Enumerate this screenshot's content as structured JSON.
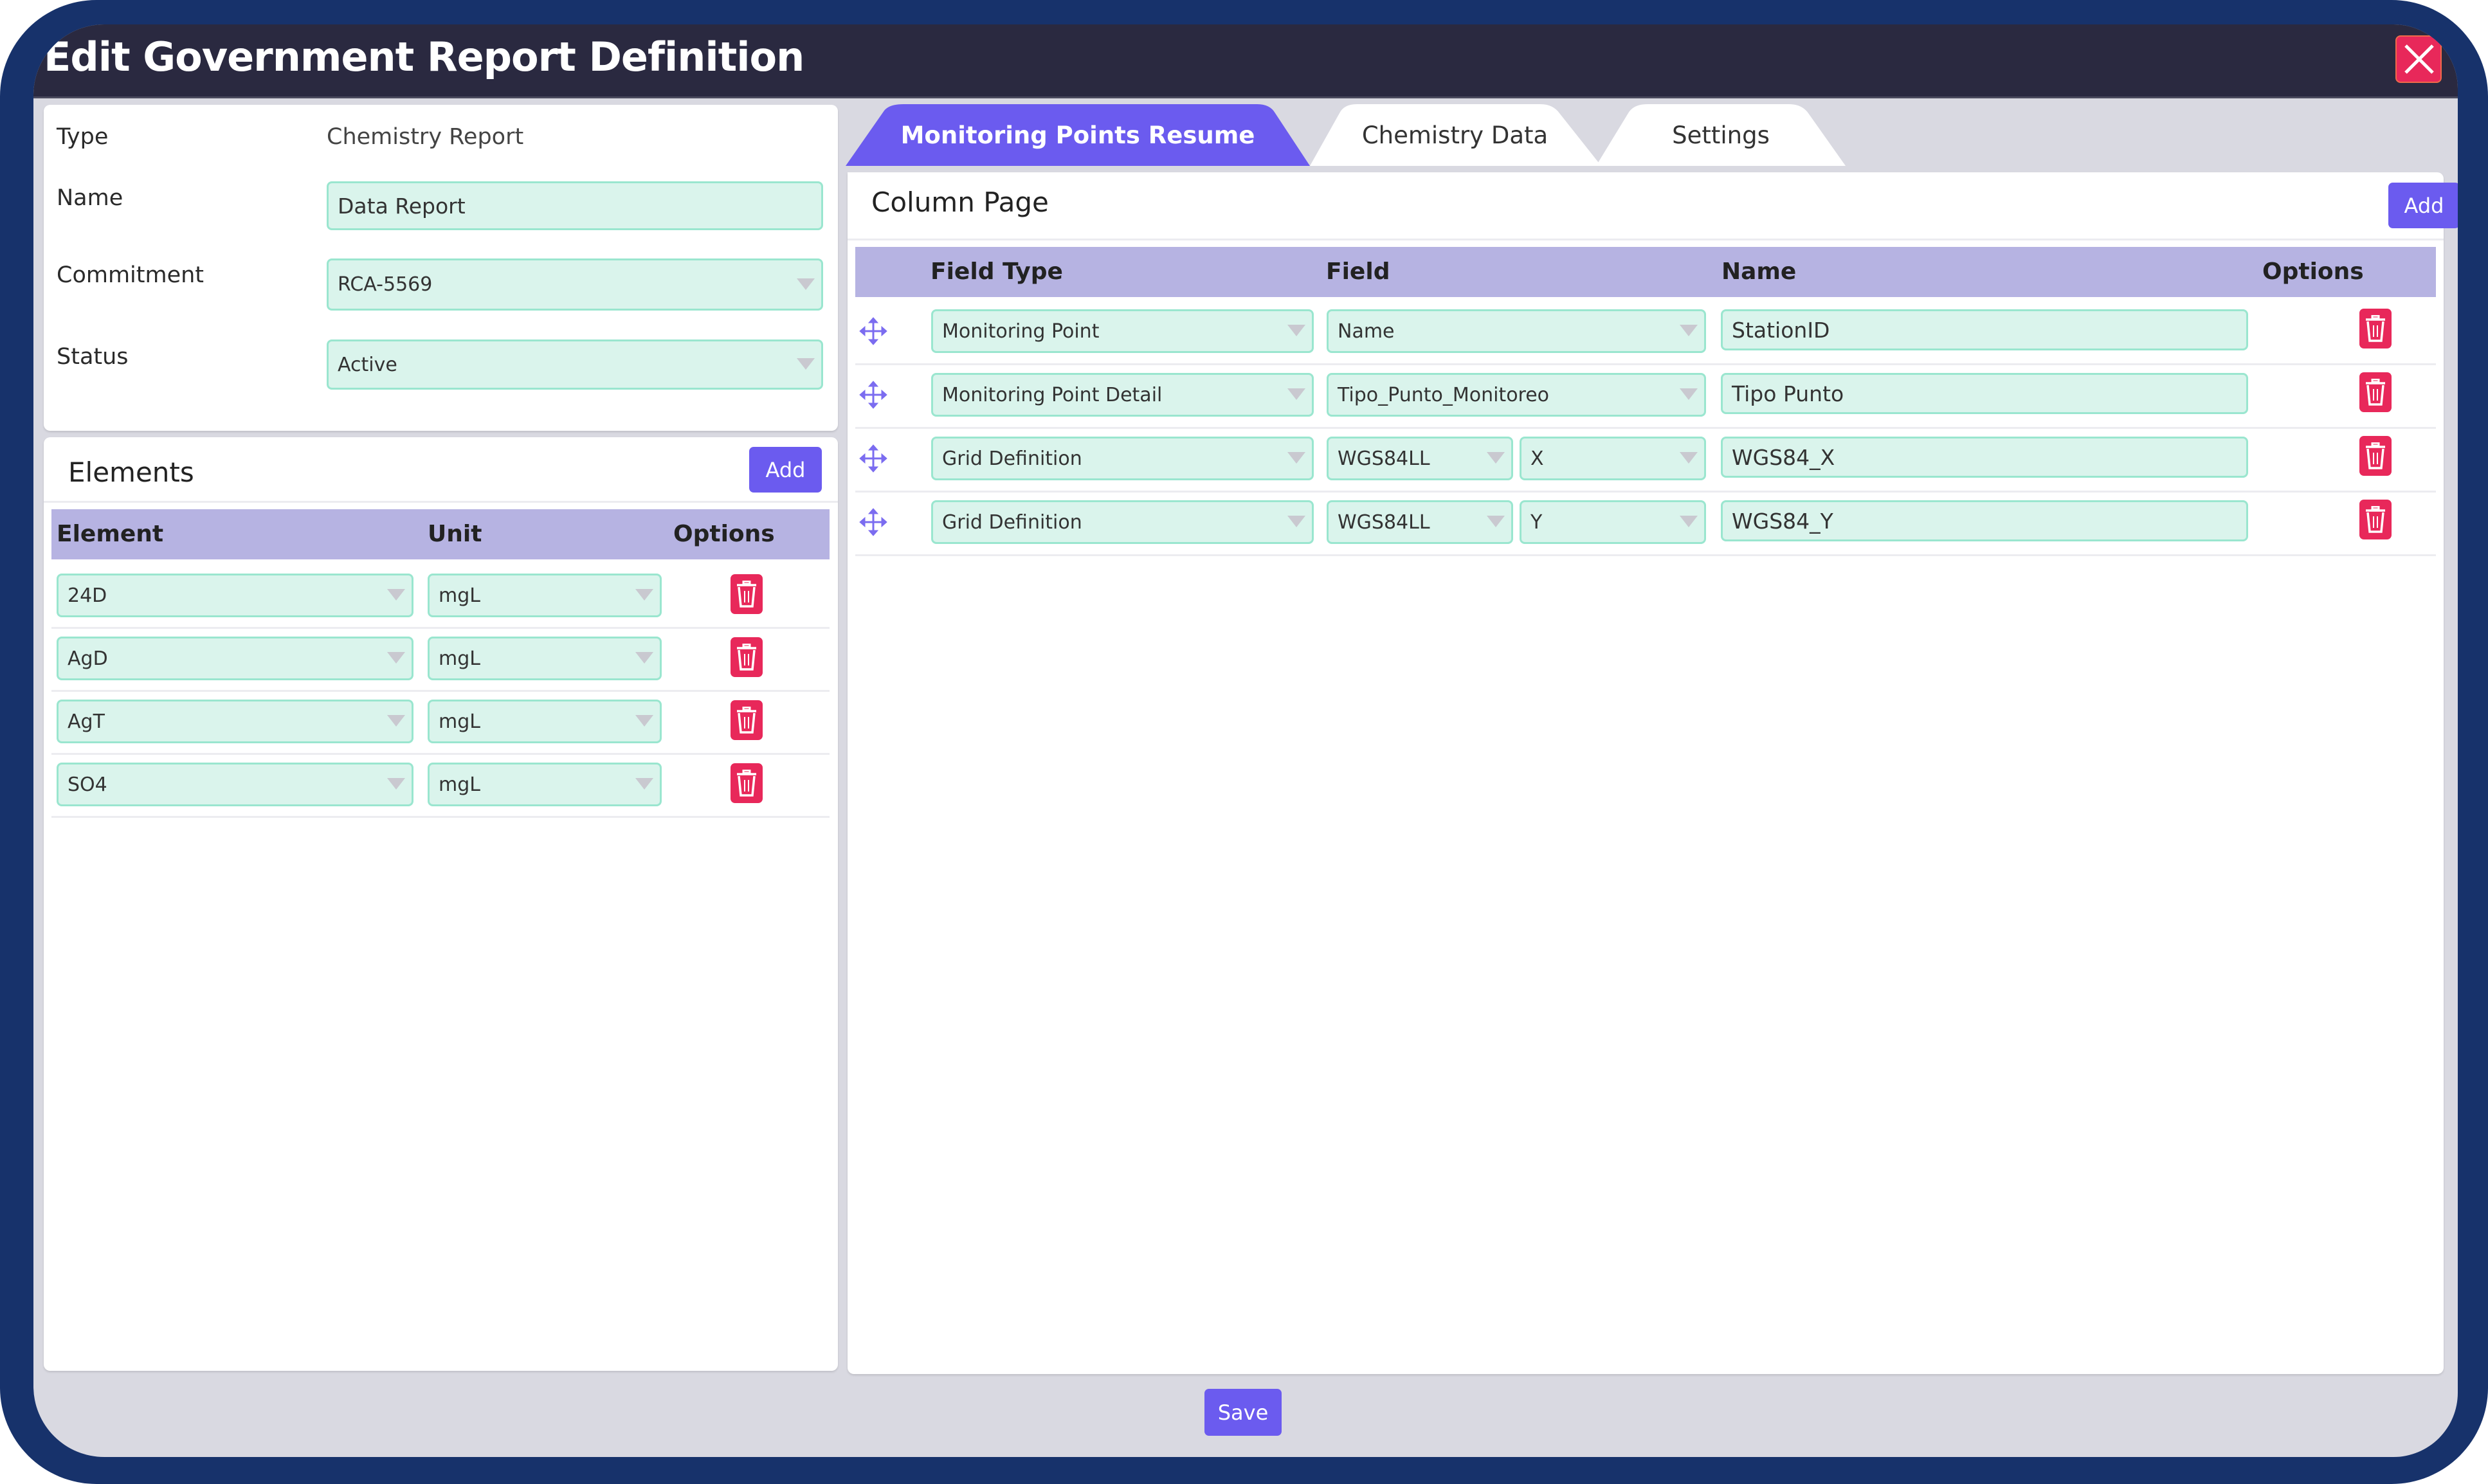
{
  "window": {
    "title": "Edit Government Report Definition",
    "close_icon": "close-icon"
  },
  "details": {
    "type_label": "Type",
    "type_value": "Chemistry Report",
    "name_label": "Name",
    "name_value": "Data Report",
    "commitment_label": "Commitment",
    "commitment_value": "RCA-5569",
    "status_label": "Status",
    "status_value": "Active"
  },
  "elements": {
    "title": "Elements",
    "add_label": "Add",
    "columns": [
      "Element",
      "Unit",
      "Options"
    ],
    "rows": [
      {
        "element": "24D",
        "unit": "mgL"
      },
      {
        "element": "AgD",
        "unit": "mgL"
      },
      {
        "element": "AgT",
        "unit": "mgL"
      },
      {
        "element": "SO4",
        "unit": "mgL"
      }
    ]
  },
  "tabs": [
    {
      "label": "Monitoring Points Resume",
      "active": true
    },
    {
      "label": "Chemistry Data",
      "active": false
    },
    {
      "label": "Settings",
      "active": false
    }
  ],
  "column_page": {
    "title": "Column Page",
    "add_label": "Add",
    "columns": [
      "Field Type",
      "Field",
      "Name",
      "Options"
    ],
    "rows": [
      {
        "field_type": "Monitoring Point",
        "field": "Name",
        "subfield": null,
        "name": "StationID"
      },
      {
        "field_type": "Monitoring Point Detail",
        "field": "Tipo_Punto_Monitoreo",
        "subfield": null,
        "name": "Tipo Punto"
      },
      {
        "field_type": "Grid Definition",
        "field": "WGS84LL",
        "subfield": "X",
        "name": "WGS84_X"
      },
      {
        "field_type": "Grid Definition",
        "field": "WGS84LL",
        "subfield": "Y",
        "name": "WGS84_Y"
      }
    ]
  },
  "footer": {
    "save_label": "Save"
  },
  "colors": {
    "accent": "#6b5bef",
    "danger": "#e8285a",
    "header_bg": "#2a2940",
    "table_header": "#b6b3e2",
    "input_bg": "#daf4ec",
    "input_border": "#9ae6cf"
  }
}
